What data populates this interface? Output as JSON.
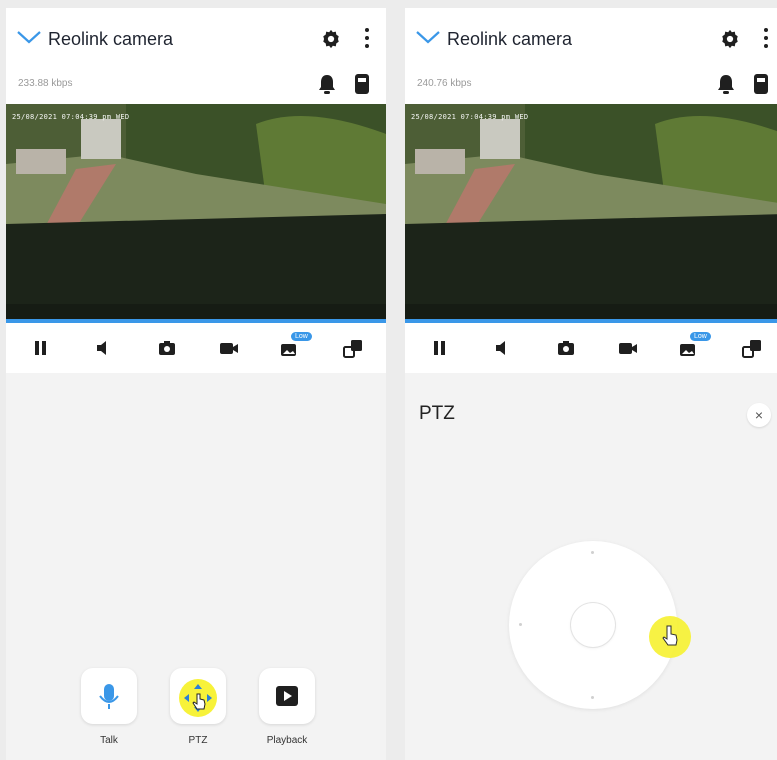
{
  "left": {
    "app_title": "Reolink camera",
    "bitrate": "233.88 kbps",
    "timestamp": "25/08/2021 07:04:39 pm WED",
    "quick_actions": [
      {
        "label": "Talk",
        "icon": "microphone-icon"
      },
      {
        "label": "PTZ",
        "icon": "ptz-arrows-icon"
      },
      {
        "label": "Playback",
        "icon": "play-icon"
      }
    ]
  },
  "right": {
    "app_title": "Reolink camera",
    "bitrate": "240.76 kbps",
    "timestamp": "25/08/2021 07:04:39 pm WED",
    "panel_title": "PTZ",
    "close_label": "×"
  },
  "controls": [
    "pause-icon",
    "speaker-icon",
    "snapshot-icon",
    "record-icon",
    "quality-icon",
    "multi-view-icon"
  ],
  "quality_badge": "Low",
  "colors": {
    "accent": "#3a97e8",
    "cursor_highlight": "#f7f23a",
    "icon_dark": "#1f1f1f"
  }
}
